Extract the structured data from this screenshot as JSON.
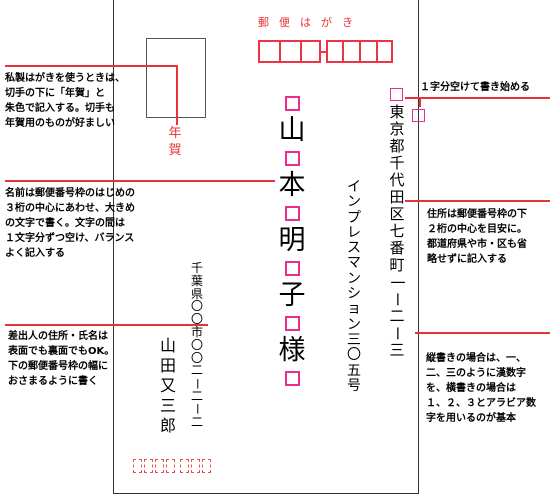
{
  "card": {
    "header": "郵便はがき",
    "nenga": "年賀",
    "recipient_address": "東京都千代田区七番町一ー二ー三",
    "recipient_building": "インプレスマンション三〇五号",
    "recipient_name": [
      "山",
      "本",
      "明",
      "子",
      "様"
    ],
    "sender_address": "千葉県〇〇市〇〇二ー二ー二",
    "sender_name": "山田又三郎"
  },
  "annotations": {
    "top_right": "１字分空けて書き始める",
    "stamp_note": [
      "私製はがきを使うときは、",
      "切手の下に「年賀」と",
      "朱色で記入する。切手も",
      "年賀用のものが好ましい"
    ],
    "name_note": [
      "名前は郵便番号枠のはじめの",
      "３桁の中心にあわせ、大きめ",
      "の文字で書く。文字の間は",
      "１文字分ずつ空け、バランス",
      "よく記入する"
    ],
    "address_note": [
      "住所は郵便番号枠の下",
      "２桁の中心を目安に。",
      "都道府県や市・区も省",
      "略せずに記入する"
    ],
    "sender_note": [
      "差出人の住所・氏名は",
      "表面でも裏面でもOK。",
      "下の郵便番号枠の幅に",
      "おさまるように書く"
    ],
    "numbers_note": [
      "縦書きの場合は、一、",
      "二、三のように漢数字",
      "を、横書きの場合は",
      "１、２、３とアラビア数",
      "字を用いるのが基本"
    ]
  },
  "colors": {
    "red": "#e8333a",
    "pink": "#ec2d8f"
  }
}
